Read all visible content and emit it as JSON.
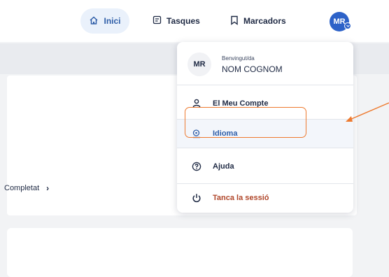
{
  "header": {
    "nav": [
      {
        "label": "Inici",
        "icon": "home-icon",
        "active": true
      },
      {
        "label": "Tasques",
        "icon": "tasks-icon"
      },
      {
        "label": "Marcadors",
        "icon": "bookmark-icon"
      }
    ],
    "avatar_initials": "MR"
  },
  "background": {
    "completed_label": "Completat"
  },
  "menu": {
    "user": {
      "initials": "MR",
      "welcome": "Benvingut/da",
      "name": "NOM COGNOM"
    },
    "items": [
      {
        "label": "El Meu Compte",
        "icon": "user-icon"
      },
      {
        "label": "Idioma",
        "icon": "language-icon"
      },
      {
        "label": "Ajuda",
        "icon": "help-icon"
      },
      {
        "label": "Tanca la sessió",
        "icon": "power-icon"
      }
    ]
  },
  "colors": {
    "accent": "#2d62c8",
    "annotation": "#ee7a2f",
    "logout": "#b0472b"
  }
}
